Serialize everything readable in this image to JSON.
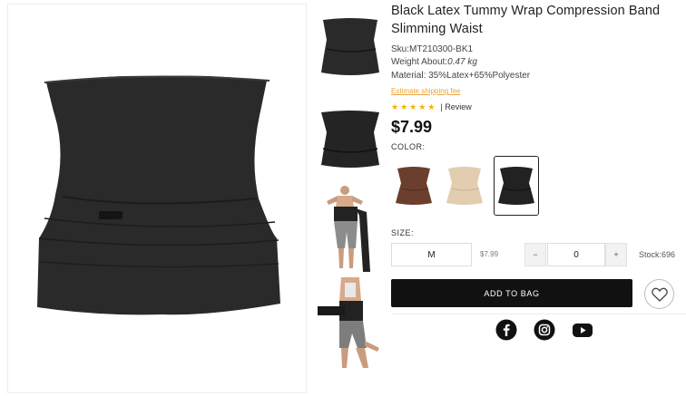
{
  "product": {
    "title": "Black Latex Tummy Wrap Compression Band Slimming Waist",
    "sku": "Sku:MT210300-BK1",
    "weight_label": "Weight About:",
    "weight_value": "0.47 kg",
    "material": "Material: 35%Latex+65%Polyester",
    "shipping_link": "Estimate shipping fee",
    "rating_stars": 5,
    "review_label": "| Review",
    "price": "$7.99"
  },
  "color": {
    "label": "COLOR:",
    "options": [
      {
        "name": "brown-swatch",
        "hex": "#6b3f2e",
        "selected": false
      },
      {
        "name": "beige-swatch",
        "hex": "#e3cdb0",
        "selected": false
      },
      {
        "name": "black-swatch",
        "hex": "#222222",
        "selected": true
      }
    ]
  },
  "size": {
    "label": "SIZE:",
    "selected": "M",
    "price": "$7.99"
  },
  "quantity": {
    "minus": "−",
    "value": "0",
    "plus": "+",
    "stock": "Stock:696"
  },
  "actions": {
    "add_to_bag": "ADD TO BAG",
    "wishlist_icon": "heart-icon"
  },
  "social": [
    "facebook-icon",
    "instagram-icon",
    "youtube-icon"
  ],
  "colors": {
    "accent_link": "#e8a33d",
    "star": "#f5b301",
    "button_bg": "#111111",
    "product_black": "#2a2a2a"
  }
}
